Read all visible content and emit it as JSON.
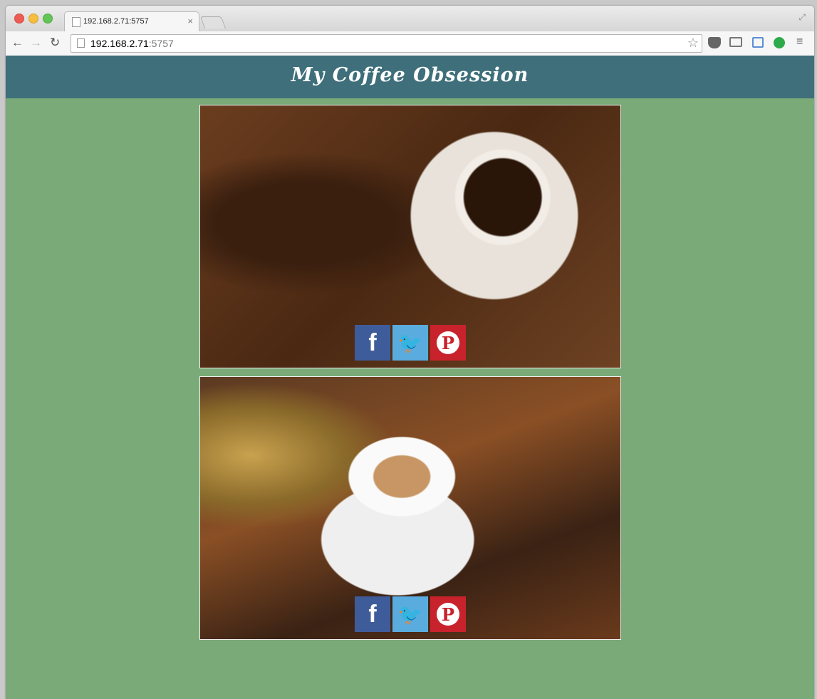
{
  "browser": {
    "tab_title": "192.168.2.71:5757",
    "url_host": "192.168.2.71",
    "url_port": ":5757",
    "tab_close": "×",
    "back": "←",
    "forward": "→",
    "reload": "↻",
    "star": "☆",
    "menu": "≡",
    "fullscreen": "⤢"
  },
  "page": {
    "title": "My Coffee Obsession",
    "background_color": "#79aa78",
    "header_color": "#3e6f7a"
  },
  "cards": [
    {
      "image": "coffee-beans-heart-cup-image",
      "social": {
        "facebook": "f",
        "twitter": "🐦",
        "pinterest": "P"
      }
    },
    {
      "image": "latte-art-vintage-table-image",
      "social": {
        "facebook": "f",
        "twitter": "🐦",
        "pinterest": "P"
      }
    }
  ]
}
